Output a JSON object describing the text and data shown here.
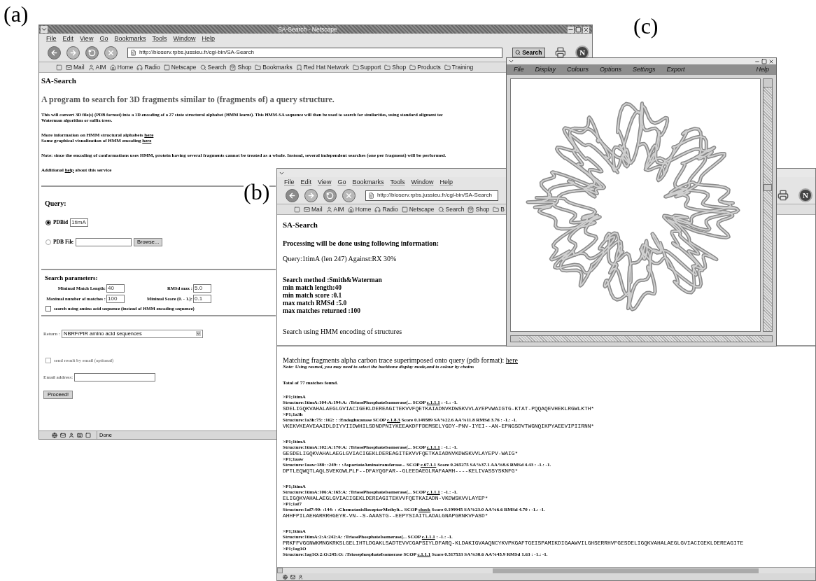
{
  "panel_labels": [
    "(a)",
    "(b)",
    "(c)"
  ],
  "window_a": {
    "title": "SA-Search - Netscape",
    "menu": [
      "File",
      "Edit",
      "View",
      "Go",
      "Bookmarks",
      "Tools",
      "Window",
      "Help"
    ],
    "url": "http://bioserv.rpbs.jussieu.fr/cgi-bin/SA-Search",
    "search_button": "Search",
    "logo": "N",
    "bookmarks": [
      {
        "label": "Mail",
        "kind": "link"
      },
      {
        "label": "AIM",
        "kind": "link"
      },
      {
        "label": "Home",
        "kind": "link"
      },
      {
        "label": "Radio",
        "kind": "link"
      },
      {
        "label": "Netscape",
        "kind": "link"
      },
      {
        "label": "Search",
        "kind": "link"
      },
      {
        "label": "Shop",
        "kind": "link"
      },
      {
        "label": "Bookmarks",
        "kind": "folder"
      },
      {
        "label": "Red Hat Network",
        "kind": "page"
      },
      {
        "label": "Support",
        "kind": "folder"
      },
      {
        "label": "Shop",
        "kind": "folder"
      },
      {
        "label": "Products",
        "kind": "folder"
      },
      {
        "label": "Training",
        "kind": "folder"
      }
    ],
    "page": {
      "heading": "SA-Search",
      "subtitle": "A program to search for 3D fragments similar to (fragments of) a query structure.",
      "intro": "This will convert 3D file(s) (PDB format) into a 1D encoding of a 27 state structural alphabet (HMM learnt). This HMM-SA sequence will then be used to search for similarities, using standard aligment tec",
      "intro_2": "Waterman algorithm or suffix trees.",
      "info_lines": [
        {
          "text": "More information on HMM structural alphabets",
          "link": "here"
        },
        {
          "text": "Some graphical visualization of HMM encoding",
          "link": "here"
        }
      ],
      "note": "Note: since the encoding of conformations uses HMM, protein having several fragments cannot be treated as a whole. Instead, several independent searches (one per fragment) will be performed.",
      "additional": {
        "before": "Additional",
        "link": "help",
        "after": "about this service"
      },
      "query": {
        "heading": "Query:",
        "options": [
          {
            "label": "PDBid",
            "selected": true,
            "value": "1timA"
          },
          {
            "label": "PDB File",
            "selected": false
          }
        ],
        "browse_button": "Browse..."
      },
      "params": {
        "heading": "Search parameters:",
        "fields": [
          {
            "label": "Minimal Match Length:",
            "value": "40"
          },
          {
            "label": "RMSd max :",
            "value": "5.0"
          },
          {
            "label": "Maximal number of matches :",
            "value": "100"
          },
          {
            "label": "Minimal Score (0. - 1.):",
            "value": "0.1"
          }
        ],
        "amino_option": {
          "label": "search using amino acid sequence (instead of HMM encoding sequence)",
          "checked": false
        }
      },
      "return": {
        "label": "Return :",
        "value": "NBRF/PIR amino acid sequences"
      },
      "email_option": {
        "label": "send result by email (optional)",
        "checked": false,
        "disabled": true
      },
      "email_label": "Email address:",
      "proceed_button": "Proceed!"
    },
    "status": "Done"
  },
  "window_b": {
    "menu": [
      "File",
      "Edit",
      "View",
      "Go",
      "Bookmarks",
      "Tools",
      "Window",
      "Help"
    ],
    "url": "http://bioserv.rpbs.jussieu.fr/cgi-bin/SA-Search",
    "logo": "N",
    "bookmarks": [
      {
        "label": "Mail",
        "kind": "link"
      },
      {
        "label": "AIM",
        "kind": "link"
      },
      {
        "label": "Home",
        "kind": "link"
      },
      {
        "label": "Radio",
        "kind": "link"
      },
      {
        "label": "Netscape",
        "kind": "link"
      },
      {
        "label": "Search",
        "kind": "link"
      },
      {
        "label": "Shop",
        "kind": "link"
      },
      {
        "label": "B",
        "kind": "folder"
      }
    ],
    "page": {
      "heading": "SA-Search",
      "processing": "Processing will be done using following information:",
      "query_line": "Query:1timA (len 247) Against:RX 30%",
      "settings": [
        "Search method :Smith&Waterman",
        "min match length:40",
        "min match score :0.1",
        "max match RMSd :5.0",
        "max matches returned :100"
      ],
      "method_line": "Search using HMM encoding of structures",
      "matching": {
        "text": "Matching fragments alpha carbon trace superimposed onto query (pdb format):",
        "link": "here"
      },
      "note": "Note: Using rasmol, you may need to select the backbone display mode,and to colour by chains",
      "total": "Total of 77 matches found.",
      "groups": [
        {
          "entries": [
            {
              "header": ">P1;1timA",
              "structure": "Structure:1timA:104:A:194:A: :TriosePhosphateIsomerase(... SCOP",
              "scop_link": "c.1.1.1",
              "details": ": -1.: -1.",
              "sequence": "SDELIGQKVAHALAEGLGVIACIGEKLDEREAGITEKVVFQETKAIADNVKDWSKVVLAYEPVWAIGTG-KTAT-PQQAQEVHEKLRGWLKTH*"
            },
            {
              "header": ">P1;1a3h",
              "structure": "Structure:1a3h:75: :162: : :Endoglucanase SCOP",
              "scop_link": "c.1.8.3",
              "details": "Score 0.149589 SA%22.6 AA%11.8 RMSd 3.76 : -1.: -1.",
              "sequence": "VKEKVKEAVEAAIDLDIYVIIDWHILSDNDPNIYKEEAKDFFDEMSELYGDY-PNV-IYEI--AN-EPNGSDVTWGNQIKPYAEEVIPIIRNN*"
            }
          ]
        },
        {
          "entries": [
            {
              "header": ">P1;1timA",
              "structure": "Structure:1timA:102:A:170:A: :TriosePhosphateIsomerase(... SCOP",
              "scop_link": "c.1.1.1",
              "details": ": -1.: -1.",
              "sequence": "GESDELIGQKVAHALAEGLGVIACIGEKLDEREAGITEKVVFQETKAIADNVKDWSKVVLAYEPV-WAIG*"
            },
            {
              "header": ">P1;1aaw",
              "structure": "Structure:1aaw:188: :249: : :AspartateAminotransferase... SCOP",
              "scop_link": "c.67.1.1",
              "details": "Score 0.265275 SA%37.1 AA%8.6 RMSd 4.43 : -1.: -1.",
              "sequence": "DPTLEQWQTLAQLSVEKGWLPLF--DFAYQGFAR--GLEEDAEGLRAFAAMH----KELIVASSYSKNFG*"
            }
          ]
        },
        {
          "entries": [
            {
              "header": ">P1;1timA",
              "structure": "Structure:1timA:106:A:165:A: :TriosePhosphateIsomerase(... SCOP",
              "scop_link": "c.1.1.1",
              "details": ": -1.: -1.",
              "sequence": "ELIGQKVAHALAEGLGVIACIGEKLDEREAGITEKVVFQETKAIADN-VKDWSKVVLAYEP*"
            },
            {
              "header": ">P1;1af7",
              "structure": "Structure:1af7:90: :144: : :ChemotaxisReceptorMethylt... SCOP",
              "scop_link": "check",
              "details": "Score 0.199945 SA%23.0 AA%6.6 RMSd 4.70 : -1.: -1.",
              "sequence": "AHHFPILAEHARRRHGEYR-VN--S-AAASTG--EEPYSIAITLADALGNAPGRNKVFASD*"
            }
          ]
        },
        {
          "entries": [
            {
              "header": ">P1;1timA",
              "structure": "Structure:1timA:2:A:242:A: :TriosePhosphateIsomerase(... SCOP",
              "scop_link": "c.1.1.1",
              "details": ": -1.: -1.",
              "sequence": "PRKFFVGGNWKMNGKRKSLGELIHTLDGAKLSADTEVVCGAPSIYLDFARQ-KLDAKIGVAAQNCYKVPKGAFTGEISPAMIKDIGAAWVILGHSERRHVFGESDELIGQKVAHALAEGLGVIACIGEKLDEREAGITE"
            },
            {
              "header": ">P1;1ag1O",
              "structure": "Structure:1ag1O:2:O:245:O: :TriosephosphateIsomerase SCOP",
              "scop_link": "c.1.1.1",
              "details": "Score 0.517533 SA%38.6 AA%45.9 RMSd 1.63 : -1.: -1."
            }
          ]
        }
      ]
    }
  },
  "window_c": {
    "menu": [
      "File",
      "Display",
      "Colours",
      "Options",
      "Settings",
      "Export"
    ],
    "help_menu": "Help"
  }
}
